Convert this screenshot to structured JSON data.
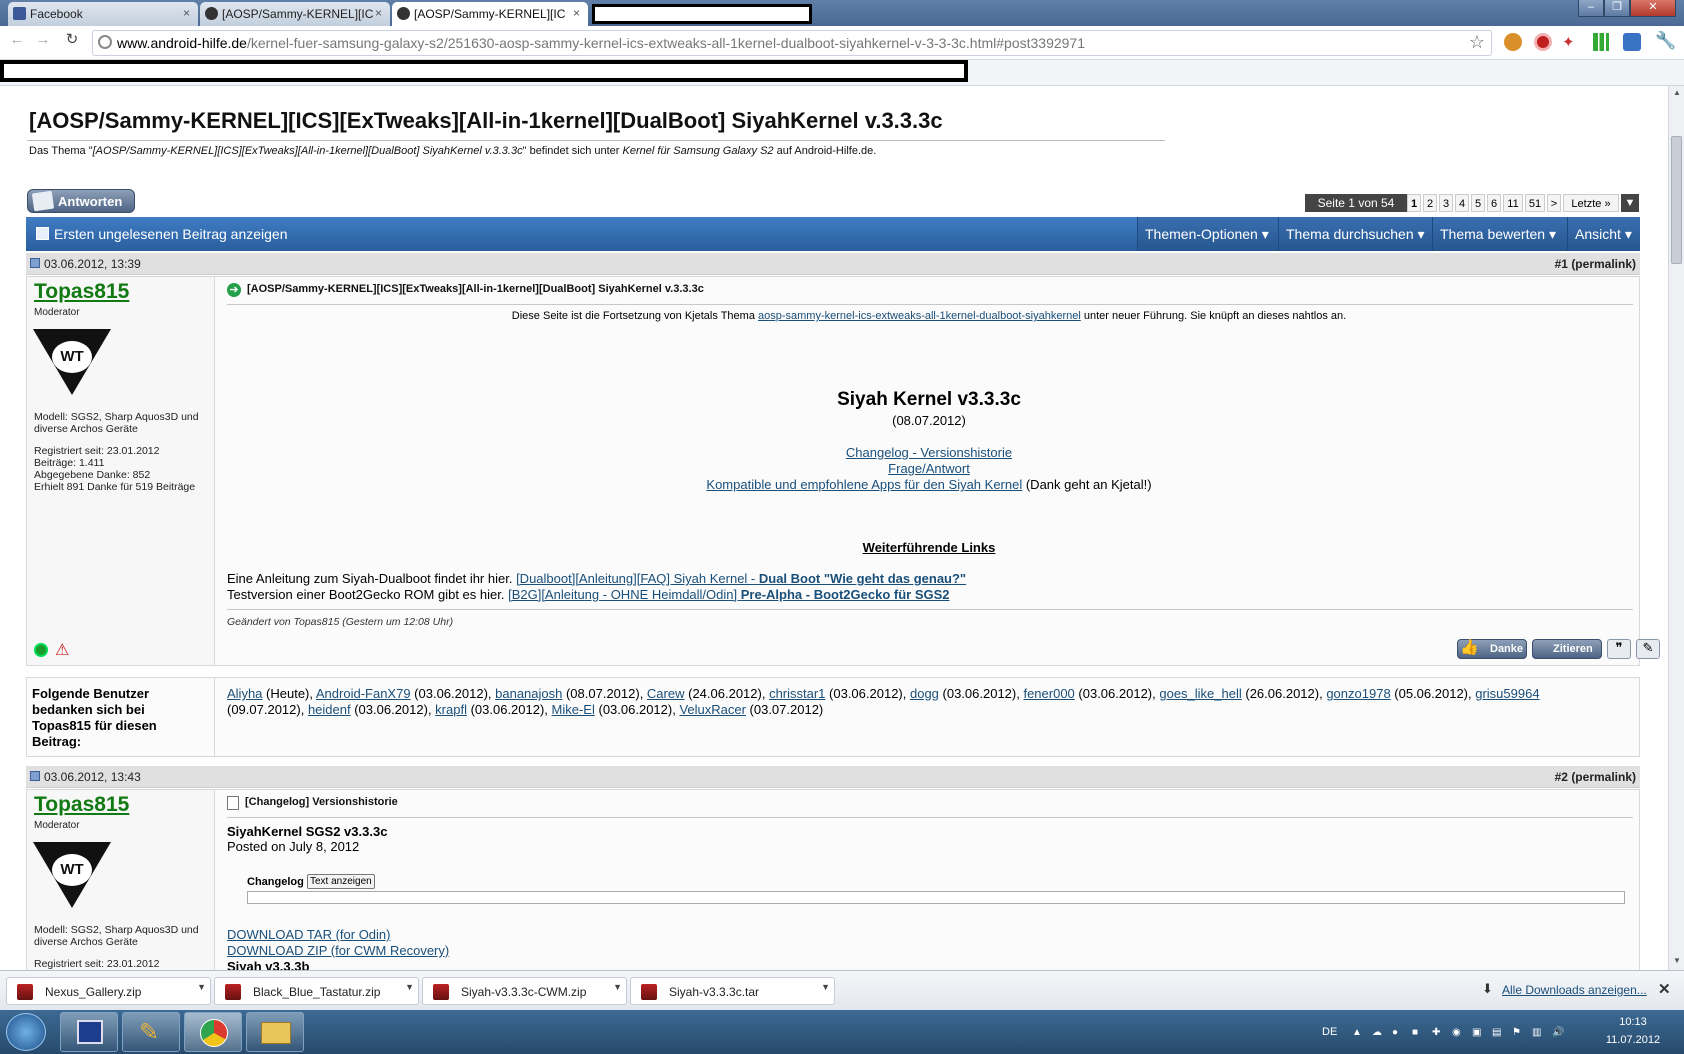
{
  "browser": {
    "tabs": [
      {
        "title": "Facebook"
      },
      {
        "title": "[AOSP/Sammy-KERNEL][IC"
      },
      {
        "title": "[AOSP/Sammy-KERNEL][IC"
      }
    ],
    "url_domain": "www.android-hilfe.de",
    "url_path": "/kernel-fuer-samsung-galaxy-s2/251630-aosp-sammy-kernel-ics-extweaks-all-1kernel-dualboot-siyahkernel-v-3-3-3c.html#post3392971",
    "window_controls": {
      "minimize": "–",
      "maximize": "❐",
      "close": "✕"
    }
  },
  "thread": {
    "title": "[AOSP/Sammy-KERNEL][ICS][ExTweaks][All-in-1kernel][DualBoot] SiyahKernel v.3.3.3c",
    "subtitle_pre": "Das Thema \"",
    "subtitle_topic": "[AOSP/Sammy-KERNEL][ICS][ExTweaks][All-in-1kernel][DualBoot] SiyahKernel v.3.3.3c",
    "subtitle_mid": "\" befindet sich unter ",
    "subtitle_forum": "Kernel für Samsung Galaxy S2",
    "subtitle_post": " auf Android-Hilfe.de.",
    "reply_button": "Antworten",
    "pagination": {
      "label": "Seite 1 von 54",
      "pages": [
        "1",
        "2",
        "3",
        "4",
        "5",
        "6",
        "11",
        "51",
        ">",
        "Letzte »"
      ]
    },
    "first_unread": "Ersten ungelesenen Beitrag anzeigen",
    "menus": [
      "Themen-Optionen",
      "Thema durchsuchen",
      "Thema bewerten",
      "Ansicht"
    ]
  },
  "post1": {
    "date": "03.06.2012, 13:39",
    "number": "#1",
    "permalink": "(permalink)",
    "user": {
      "name": "Topas815",
      "role": "Moderator",
      "model": "Modell: SGS2, Sharp Aquos3D und diverse Archos Geräte",
      "registered": "Registriert seit: 23.01.2012",
      "posts": "Beiträge: 1.411",
      "thanks_given": "Abgegebene Danke: 852",
      "thanks_received": "Erhielt 891 Danke für 519 Beiträge"
    },
    "title": "[AOSP/Sammy-KERNEL][ICS][ExTweaks][All-in-1kernel][DualBoot] SiyahKernel v.3.3.3c",
    "intro_pre": "Diese Seite ist die Fortsetzung von Kjetals Thema ",
    "intro_link": "aosp-sammy-kernel-ics-extweaks-all-1kernel-dualboot-siyahkernel",
    "intro_post": " unter neuer Führung. Sie knüpft an dieses nahtlos an.",
    "heading": "Siyah Kernel v3.3.3c",
    "date_line": "(08.07.2012)",
    "link_changelog": "Changelog - Versionshistorie",
    "link_faq": "Frage/Antwort",
    "link_apps": "Kompatible und empfohlene Apps für den Siyah Kernel",
    "apps_note": " (Dank geht an Kjetal!)",
    "more_links": "Weiterführende Links",
    "dual_pre": "Eine Anleitung zum Siyah-Dualboot findet ihr hier. ",
    "dual_link": "[Dualboot][Anleitung][FAQ] Siyah Kernel - ",
    "dual_bold": "Dual Boot \"Wie geht das genau?\"",
    "b2g_pre": "Testversion einer Boot2Gecko ROM gibt es hier. ",
    "b2g_link": "[B2G][Anleitung - OHNE Heimdall/Odin] ",
    "b2g_bold": "Pre-Alpha - Boot2Gecko für SGS2",
    "edited": "Geändert von Topas815 (Gestern um 12:08 Uhr)",
    "btn_danke": "Danke",
    "btn_zitieren": "Zitieren"
  },
  "thanks": {
    "label": "Folgende Benutzer bedanken sich bei Topas815 für diesen Beitrag:",
    "users": [
      {
        "name": "Aliyha",
        "date": " (Heute), "
      },
      {
        "name": "Android-FanX79",
        "date": " (03.06.2012), "
      },
      {
        "name": "bananajosh",
        "date": " (08.07.2012), "
      },
      {
        "name": "Carew",
        "date": " (24.06.2012), "
      },
      {
        "name": "chrisstar1",
        "date": " (03.06.2012), "
      },
      {
        "name": "dogg",
        "date": " (03.06.2012), "
      },
      {
        "name": "fener000",
        "date": " (03.06.2012), "
      },
      {
        "name": "goes_like_hell",
        "date": " (26.06.2012), "
      },
      {
        "name": "gonzo1978",
        "date": " (05.06.2012), "
      },
      {
        "name": "grisu59964",
        "date": " (09.07.2012), "
      },
      {
        "name": "heidenf",
        "date": " (03.06.2012), "
      },
      {
        "name": "krapfl",
        "date": " (03.06.2012), "
      },
      {
        "name": "Mike-El",
        "date": " (03.06.2012), "
      },
      {
        "name": "VeluxRacer",
        "date": " (03.07.2012)"
      }
    ]
  },
  "post2": {
    "date": "03.06.2012, 13:43",
    "number": "#2",
    "permalink": "(permalink)",
    "user": {
      "name": "Topas815",
      "role": "Moderator",
      "model": "Modell: SGS2, Sharp Aquos3D und diverse Archos Geräte",
      "registered": "Registriert seit: 23.01.2012"
    },
    "title": "[Changelog] Versionshistorie",
    "heading": "SiyahKernel SGS2 v3.3.3c",
    "posted": "Posted on July 8, 2012",
    "spoiler_label": "Changelog",
    "spoiler_button": "Text anzeigen",
    "dl_tar": "DOWNLOAD TAR (for Odin)",
    "dl_zip": "DOWNLOAD ZIP (for CWM Recovery)",
    "next_heading": "Siyah v3.3.3b"
  },
  "downloads": {
    "items": [
      "Nexus_Gallery.zip",
      "Black_Blue_Tastatur.zip",
      "Siyah-v3.3.3c-CWM.zip",
      "Siyah-v3.3.3c.tar"
    ],
    "show_all": "Alle Downloads anzeigen...",
    "close": "✕"
  },
  "taskbar": {
    "lang": "DE",
    "time": "10:13",
    "date": "11.07.2012"
  }
}
